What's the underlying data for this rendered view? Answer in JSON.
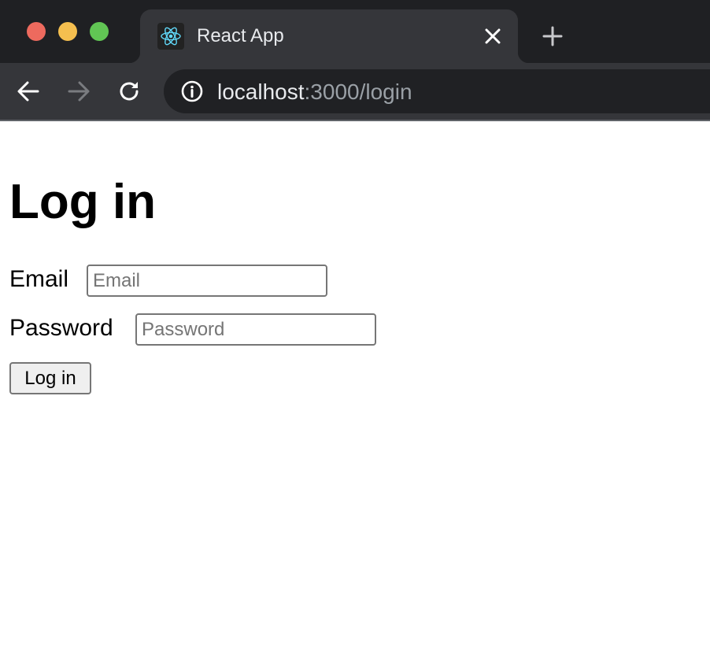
{
  "browser": {
    "tab": {
      "title": "React App",
      "favicon": "react-logo-icon"
    },
    "icons": {
      "close": "close-icon",
      "new_tab": "plus-icon",
      "back": "back-arrow-icon",
      "forward": "forward-arrow-icon",
      "reload": "reload-icon",
      "site_info": "info-icon"
    },
    "address": {
      "host": "localhost",
      "rest": ":3000/login"
    },
    "colors": {
      "chrome_dark": "#1f2023",
      "chrome_tab": "#35363a",
      "omnibox": "#202124",
      "traffic_red": "#ed6a5e",
      "traffic_yellow": "#f5bf4f",
      "traffic_green": "#61c554",
      "react_blue": "#61dafb"
    }
  },
  "page": {
    "heading": "Log in",
    "email": {
      "label": "Email",
      "placeholder": "Email",
      "value": ""
    },
    "password": {
      "label": "Password",
      "placeholder": "Password",
      "value": ""
    },
    "submit_label": "Log in"
  }
}
